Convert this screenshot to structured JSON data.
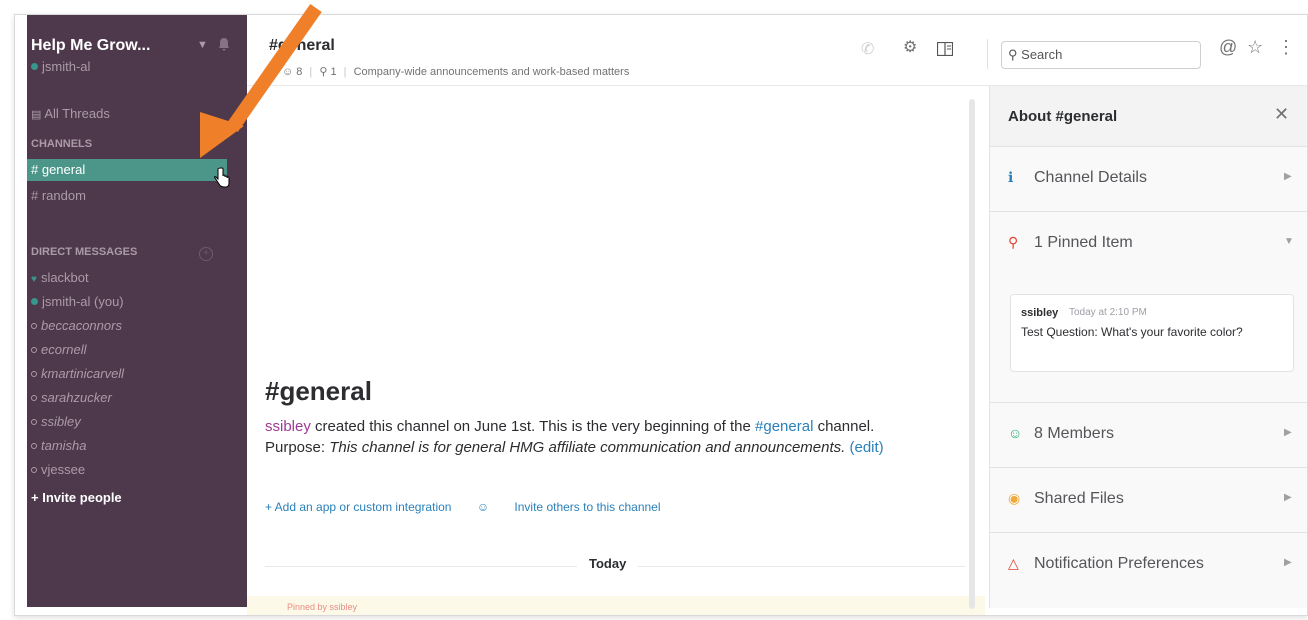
{
  "sidebar": {
    "team_name": "Help Me Grow...",
    "current_user": "jsmith-al",
    "all_threads": "All Threads",
    "channels_header": "CHANNELS",
    "channels": [
      {
        "label": "# general",
        "active": true
      },
      {
        "label": "# random",
        "active": false
      }
    ],
    "dm_header": "DIRECT MESSAGES",
    "direct_messages": [
      {
        "label": "slackbot",
        "status": "bot"
      },
      {
        "label": "jsmith-al (you)",
        "status": "online"
      },
      {
        "label": "beccaconnors",
        "status": "away"
      },
      {
        "label": "ecornell",
        "status": "away"
      },
      {
        "label": "kmartinicarvell",
        "status": "away"
      },
      {
        "label": "sarahzucker",
        "status": "away"
      },
      {
        "label": "ssibley",
        "status": "away"
      },
      {
        "label": "tamisha",
        "status": "away"
      },
      {
        "label": "vjessee",
        "status": "away"
      }
    ],
    "invite_people": "+ Invite people"
  },
  "header": {
    "channel_name": "#general",
    "member_count": "8",
    "pinned_count": "1",
    "purpose": "Company-wide announcements and work-based matters",
    "search_placeholder": "Search"
  },
  "intro": {
    "title": "#general",
    "creator": "ssibley",
    "created_text": " created this channel on June 1st. This is the very beginning of the ",
    "channel_link": "#general",
    "purpose_prefix": " channel. Purpose: ",
    "purpose_text": "This channel is for general HMG affiliate communication and announcements.",
    "edit_link": "(edit)",
    "add_app": "+ Add an app or custom integration",
    "invite_others": "Invite others to this channel"
  },
  "timeline": {
    "divider_label": "Today",
    "pinned_by": "Pinned by ssibley"
  },
  "flexpane": {
    "title": "About #general",
    "sections": {
      "channel_details": "Channel Details",
      "pinned": "1 Pinned Item",
      "members": "8 Members",
      "shared_files": "Shared Files",
      "notification_prefs": "Notification Preferences"
    },
    "pinned_message": {
      "author": "ssibley",
      "time": "Today at 2:10 PM",
      "text": "Test Question: What's your favorite color?"
    }
  },
  "colors": {
    "sidebar_bg": "#4d394b",
    "active_channel": "#4c9689",
    "link": "#2a80b9",
    "annotation_arrow": "#f07f2a"
  }
}
